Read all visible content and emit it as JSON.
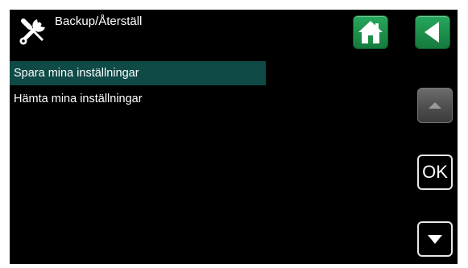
{
  "header": {
    "title": "Backup/Återställ",
    "icon": "tools-icon"
  },
  "nav": {
    "home_icon": "home-icon",
    "back_icon": "back-arrow-icon",
    "button_color": "#1d8e4a"
  },
  "menu": {
    "items": [
      {
        "label": "Spara mina inställningar",
        "selected": true
      },
      {
        "label": "Hämta mina inställningar",
        "selected": false
      }
    ],
    "selected_color": "#0f4a47"
  },
  "side_controls": {
    "up_icon": "arrow-up-icon",
    "ok_label": "OK",
    "down_icon": "arrow-down-icon"
  }
}
